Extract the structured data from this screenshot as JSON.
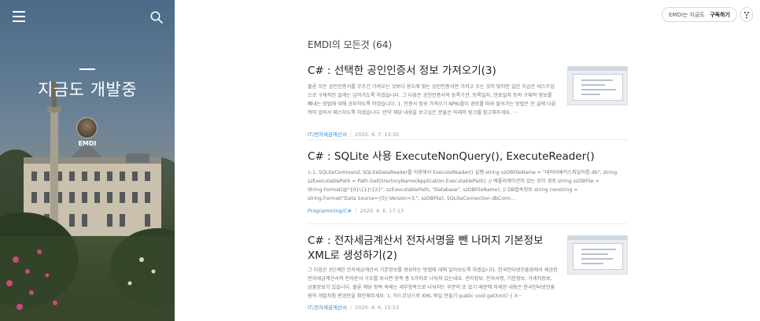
{
  "blog": {
    "title": "지금도 개발중",
    "author": "EMDI"
  },
  "icons": {
    "menu": "hamburger-menu-icon",
    "search": "search-icon",
    "more": "more-dots-icon"
  },
  "subscribe": {
    "blog_label": "EMDI는 지금도 ···",
    "button_label": "구독하기"
  },
  "main": {
    "heading": "EMDI의 모든것 (64)",
    "posts": [
      {
        "title": "C# : 선택한 공인인증서 정보 가져오기(3)",
        "excerpt": "볼론 모든 공인인증서를 무조건 가져오는 것보다 용도에 맞는 공인인증서만 가지고 오는 것이 맞지만 일단 지금은 테스트임으로 구체적인 설계는 넘어가도록 하겠습니다. 그 다음은 공인인증서의 등록기관, 등록일자, 만료일자 등의 구체적 정보를 빼내는 방법에 대해 공부하도록 하겠습니다. 1. 인증서 정보 가져오기 NPKI폴더 경로를 따라 들어가는 방법은 전 글에 다룬 적이 있어서 패스하도록 하겠습니다. 만약 해당 내용을 보고싶은 분들은 아래의 링크를 참고해주세요. ···",
        "category": "IT/전자세금계산서",
        "date": "2020. 4. 7. 13:30",
        "has_thumbnail": true
      },
      {
        "title": "C# : SQLite 사용 ExecuteNonQuery(), ExecuteReader()",
        "excerpt": "1-1. SQLiteCommand, SQLiteDataReader를 이용해서 ExecuteReader() 실행 string szDBFileName = \"데이터베이스파일이름.db\"; string szExecutablePath = Path.GetDirectoryName(Application.ExecutablePath); // 애플리케이션이 있는 위치 경로 string szDBFile = String.Format(@\"{0}\\{1}\\{2}\", szExecutablePath, \"Database\", szDBFileName); // DB접속정보 string constring = string.Format(\"Data Source={0};Version=3;\", szDBFile); SQLiteConnection dbConn...",
        "category": "Programming/C#",
        "date": "2020. 4. 6. 17:13",
        "has_thumbnail": false
      },
      {
        "title": "C# : 전자세금계산서 전자서명을 뺀 나머지 기본정보 XML로 생성하기(2)",
        "excerpt": "그 다음은 3단계인 전자세금계산서 기본정보를 생성하는 방법에 대해 알아보도록 하겠습니다. 한국인터넷진흥원에서 제공한 전자세금계산서의 전자문서 구조를 보시면 항목 총 5가지로 나눠져 있는데요. 관리정보, 전자서명, 기본정보, 거래처정보, 상품정보가 있습니다. 볼론 해당 항목 속에는 세부항목으로 나눠지는 부분이 또 있기 때문에 자세한 내용은 한국인터넷진흥원의 개발지침 변경안을 확인해주세요. 1. 하드코딩으로 XML 파일 만들기 public void getXml() { X···",
        "category": "IT/전자세금계산서",
        "date": "2020. 4. 6. 15:53",
        "has_thumbnail": true
      }
    ]
  }
}
